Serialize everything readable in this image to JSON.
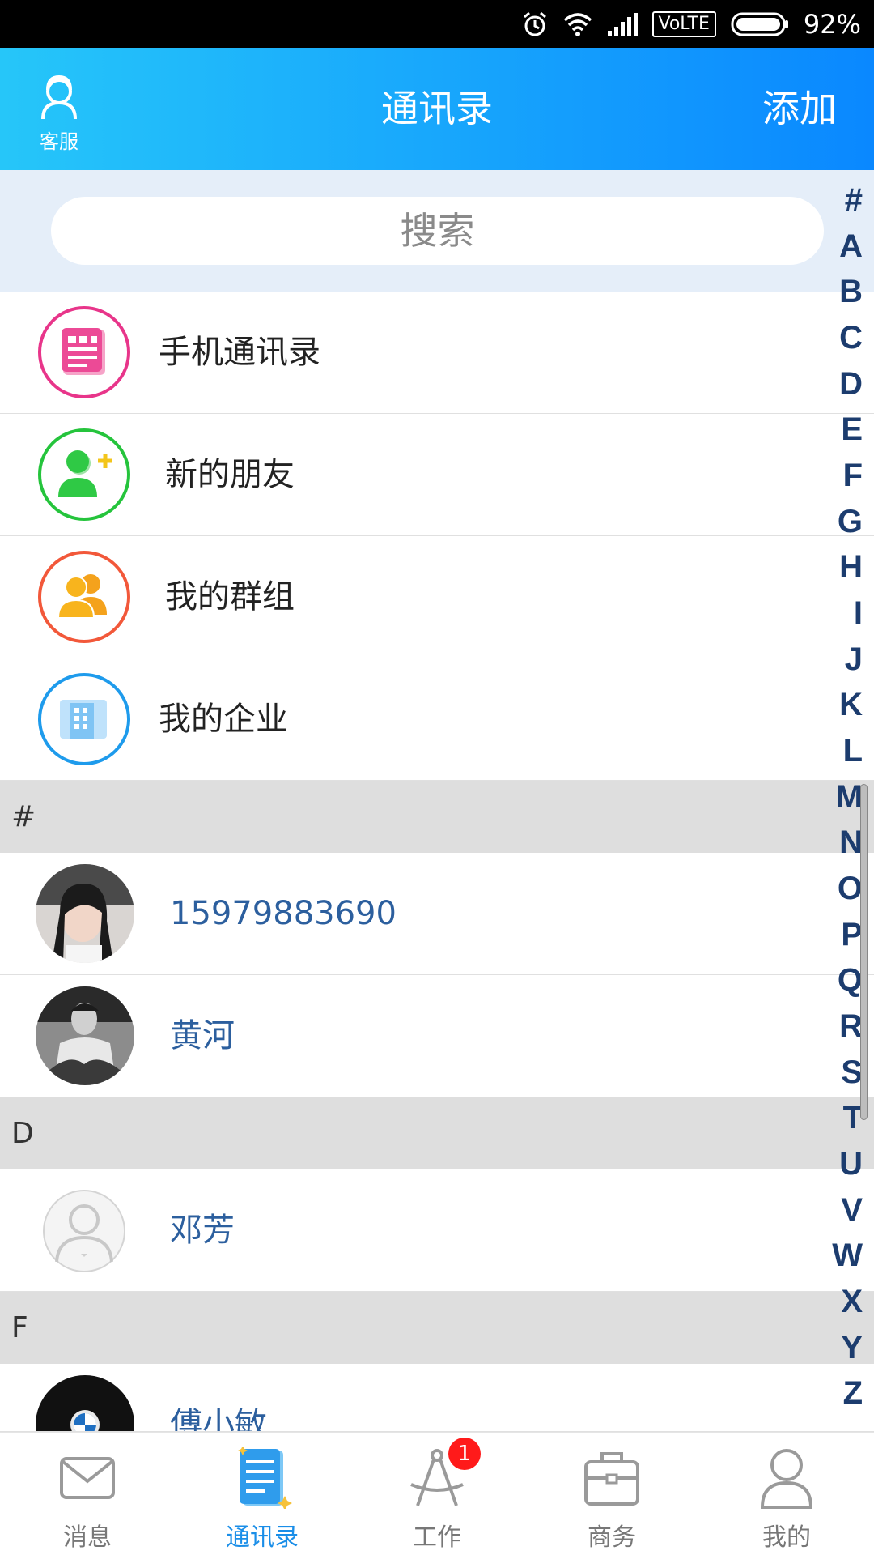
{
  "status_bar": {
    "network_type": "VoLTE",
    "battery": "92%"
  },
  "header": {
    "title": "通讯录",
    "customer_service_label": "客服",
    "add_label": "添加"
  },
  "search": {
    "placeholder": "搜索"
  },
  "functions": [
    {
      "label": "手机通讯录",
      "icon": "phone-book-icon",
      "color": "#e8358a"
    },
    {
      "label": "新的朋友",
      "icon": "new-friend-icon",
      "color": "#25c43c"
    },
    {
      "label": "我的群组",
      "icon": "group-icon",
      "color": "#f2583a"
    },
    {
      "label": "我的企业",
      "icon": "enterprise-icon",
      "color": "#1e9bec"
    }
  ],
  "sections": [
    {
      "letter": "#",
      "contacts": [
        {
          "name": "15979883690"
        },
        {
          "name": "黄河"
        }
      ]
    },
    {
      "letter": "D",
      "contacts": [
        {
          "name": "邓芳"
        }
      ]
    },
    {
      "letter": "F",
      "contacts": [
        {
          "name": "傅小敏"
        }
      ]
    }
  ],
  "index_letters": [
    "#",
    "A",
    "B",
    "C",
    "D",
    "E",
    "F",
    "G",
    "H",
    "I",
    "J",
    "K",
    "L",
    "M",
    "N",
    "O",
    "P",
    "Q",
    "R",
    "S",
    "T",
    "U",
    "V",
    "W",
    "X",
    "Y",
    "Z"
  ],
  "bottom_nav": [
    {
      "label": "消息",
      "icon": "mail-icon",
      "active": false
    },
    {
      "label": "通讯录",
      "icon": "contacts-book-icon",
      "active": true
    },
    {
      "label": "工作",
      "icon": "compass-icon",
      "active": false,
      "badge": "1"
    },
    {
      "label": "商务",
      "icon": "briefcase-icon",
      "active": false
    },
    {
      "label": "我的",
      "icon": "person-icon",
      "active": false
    }
  ],
  "colors": {
    "header_start": "#26c6f9",
    "header_end": "#0a88ff",
    "active_tab": "#1a8ee8",
    "contact_name": "#2c5f9e",
    "badge": "#ff1a1a"
  }
}
